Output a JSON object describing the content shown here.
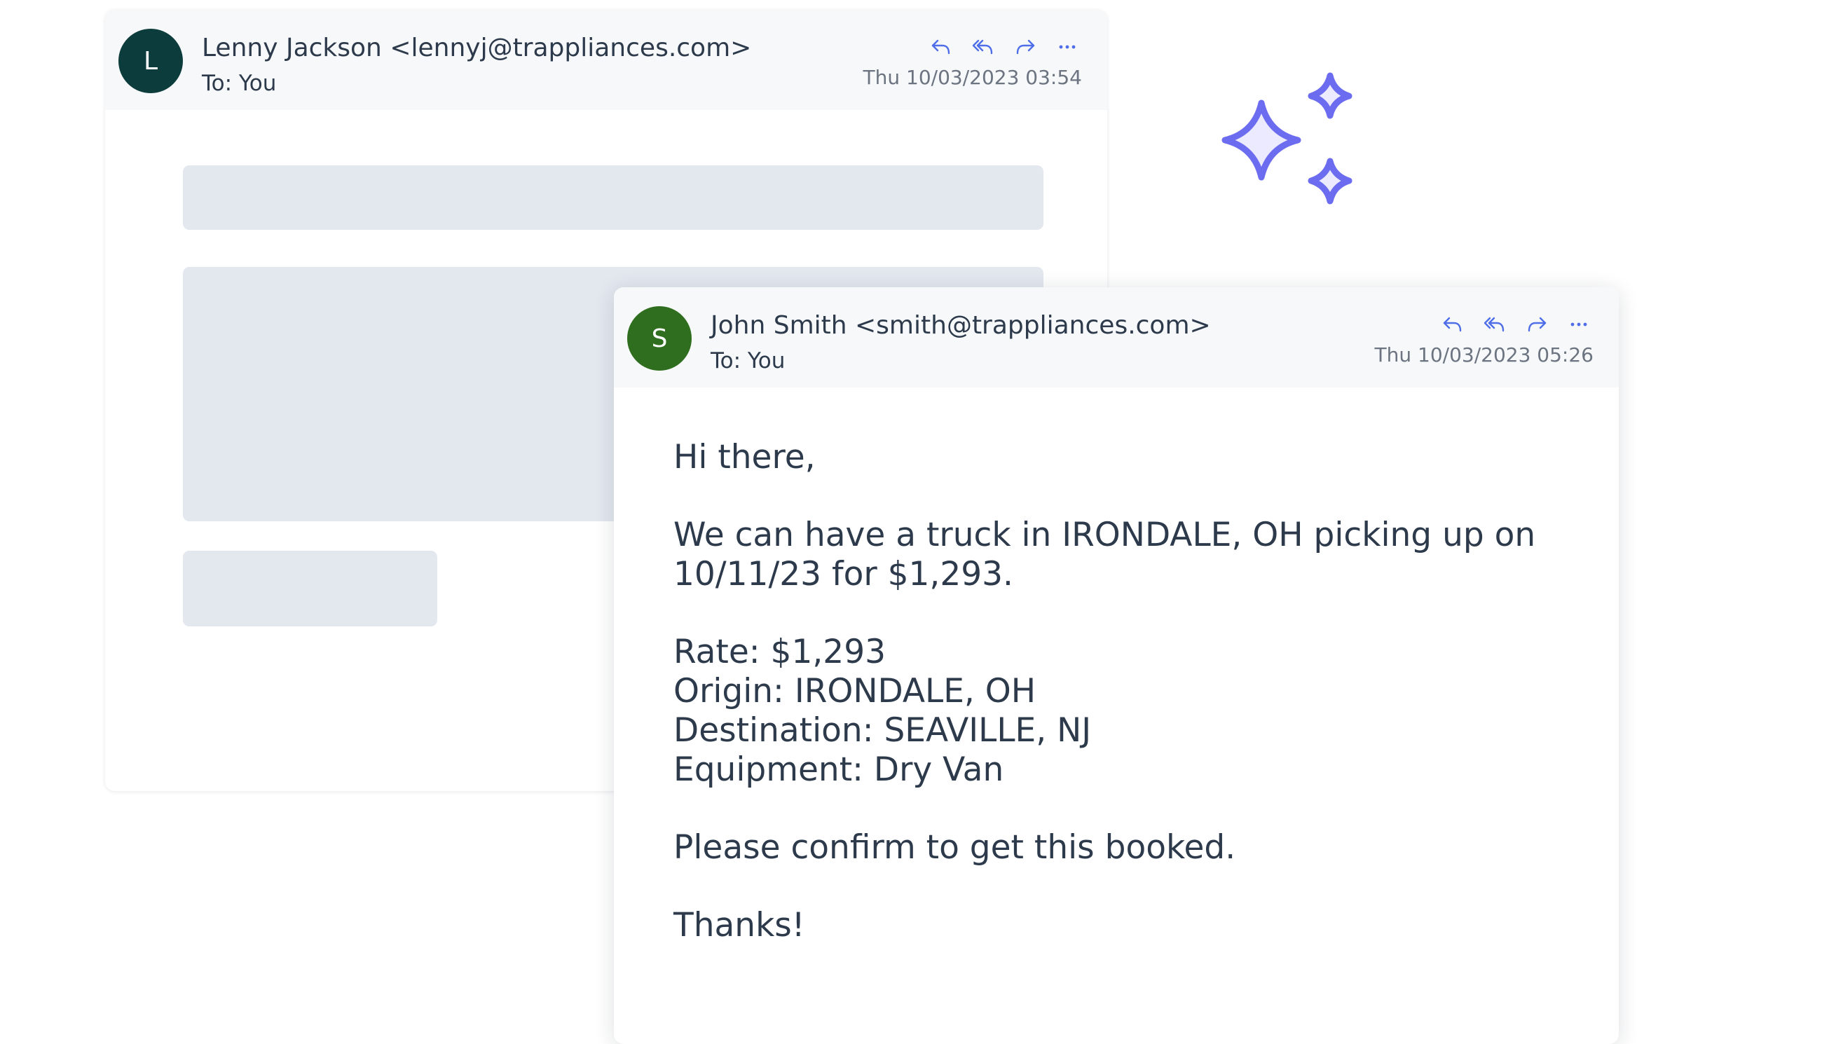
{
  "colors": {
    "sparkle": "#6c6cf0",
    "avatar_lenny": "#0d3c3c",
    "avatar_john": "#2e6e1e",
    "skeleton": "#e3e8ef"
  },
  "icons": [
    "reply-icon",
    "reply-all-icon",
    "forward-icon",
    "more-icon",
    "sparkles-icon"
  ],
  "back_email": {
    "avatar_initial": "L",
    "sender": "Lenny Jackson <lennyj@trappliances.com>",
    "to": "To: You",
    "date": "Thu 10/03/2023 03:54"
  },
  "front_email": {
    "avatar_initial": "S",
    "sender": "John Smith <smith@trappliances.com>",
    "to": "To: You",
    "date": "Thu 10/03/2023 05:26",
    "greeting": "Hi there,",
    "paragraph_line1": "We can have a truck in IRONDALE, OH picking up on",
    "paragraph_line2": "10/11/23 for $1,293.",
    "rate": "Rate: $1,293",
    "origin": "Origin: IRONDALE, OH",
    "destination": "Destination: SEAVILLE, NJ",
    "equipment": "Equipment: Dry Van",
    "confirm": "Please confirm to get this booked.",
    "signoff": "Thanks!"
  }
}
